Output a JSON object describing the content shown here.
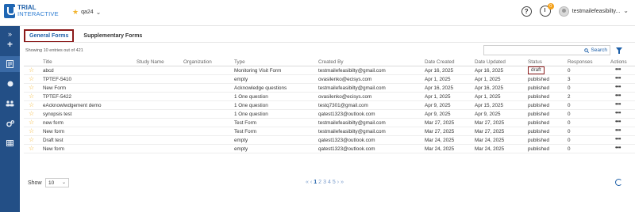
{
  "app": {
    "brand_top": "TRIAL",
    "brand_bottom": "INTERACTIVE",
    "workspace": "qa24",
    "user": "testmailefeasibilty..."
  },
  "notifications": {
    "badge": "0"
  },
  "help": {
    "label": "?"
  },
  "sidebar": {
    "toggle": "»",
    "items": [
      "add-icon",
      "forms-icon",
      "circle-icon",
      "users-icon",
      "settings-icon",
      "grid-icon"
    ]
  },
  "tabs": [
    "General Forms",
    "Supplementary Forms"
  ],
  "search": {
    "label": "Search"
  },
  "showing": "Showing 10 entries out of 421",
  "columns": [
    "Title",
    "Study Name",
    "Organization",
    "Type",
    "Created By",
    "Date Created",
    "Date Updated",
    "Status",
    "Responses",
    "Actions"
  ],
  "rows": [
    {
      "title": "abcd",
      "study": "",
      "org": "",
      "type": "Monitoring Visit Form",
      "created_by": "testmailefeasibilty@gmail.com",
      "date_created": "Apr 16, 2025",
      "date_updated": "Apr 16, 2025",
      "status": "draft",
      "responses": "0",
      "actions": "•••"
    },
    {
      "title": "TPTEF-5410",
      "study": "",
      "org": "",
      "type": "empty",
      "created_by": "ovasilenko@ecisys.com",
      "date_created": "Apr 1, 2025",
      "date_updated": "Apr 1, 2025",
      "status": "published",
      "responses": "3",
      "actions": "•••"
    },
    {
      "title": "New Form",
      "study": "",
      "org": "",
      "type": "Acknowledge questions",
      "created_by": "testmailefeasibilty@gmail.com",
      "date_created": "Apr 16, 2025",
      "date_updated": "Apr 16, 2025",
      "status": "published",
      "responses": "0",
      "actions": "•••"
    },
    {
      "title": "TPTEF-5422",
      "study": "",
      "org": "",
      "type": "1 One question",
      "created_by": "ovasilenko@ecisys.com",
      "date_created": "Apr 1, 2025",
      "date_updated": "Apr 1, 2025",
      "status": "published",
      "responses": "2",
      "actions": "•••"
    },
    {
      "title": "eAcknowlwdgement demo",
      "study": "",
      "org": "",
      "type": "1 One question",
      "created_by": "testq7301@gmail.com",
      "date_created": "Apr 9, 2025",
      "date_updated": "Apr 15, 2025",
      "status": "published",
      "responses": "0",
      "actions": "•••"
    },
    {
      "title": "synopsis test",
      "study": "",
      "org": "",
      "type": "1 One question",
      "created_by": "qatest1323@outlook.com",
      "date_created": "Apr 9, 2025",
      "date_updated": "Apr 9, 2025",
      "status": "published",
      "responses": "0",
      "actions": "•••"
    },
    {
      "title": "new form",
      "study": "",
      "org": "",
      "type": "Test Form",
      "created_by": "testmailefeasibilty@gmail.com",
      "date_created": "Mar 27, 2025",
      "date_updated": "Mar 27, 2025",
      "status": "published",
      "responses": "0",
      "actions": "•••"
    },
    {
      "title": "New form",
      "study": "",
      "org": "",
      "type": "Test Form",
      "created_by": "testmailefeasibilty@gmail.com",
      "date_created": "Mar 27, 2025",
      "date_updated": "Mar 27, 2025",
      "status": "published",
      "responses": "0",
      "actions": "•••"
    },
    {
      "title": "Draft test",
      "study": "",
      "org": "",
      "type": "empty",
      "created_by": "qatest1323@outlook.com",
      "date_created": "Mar 24, 2025",
      "date_updated": "Mar 24, 2025",
      "status": "published",
      "responses": "0",
      "actions": "•••"
    },
    {
      "title": "New form",
      "study": "",
      "org": "",
      "type": "empty",
      "created_by": "qatest1323@outlook.com",
      "date_created": "Mar 24, 2025",
      "date_updated": "Mar 24, 2025",
      "status": "published",
      "responses": "0",
      "actions": "•••"
    }
  ],
  "footer": {
    "show_label": "Show",
    "page_size": "10",
    "pages": [
      "1",
      "2",
      "3",
      "4",
      "5"
    ],
    "first": "«",
    "prev": "‹",
    "next": "›",
    "last": "»"
  },
  "colors": {
    "sidebar": "#234f86",
    "accent": "#1d5fa8",
    "star": "#f2b531",
    "highlight": "#8b1a1a"
  }
}
